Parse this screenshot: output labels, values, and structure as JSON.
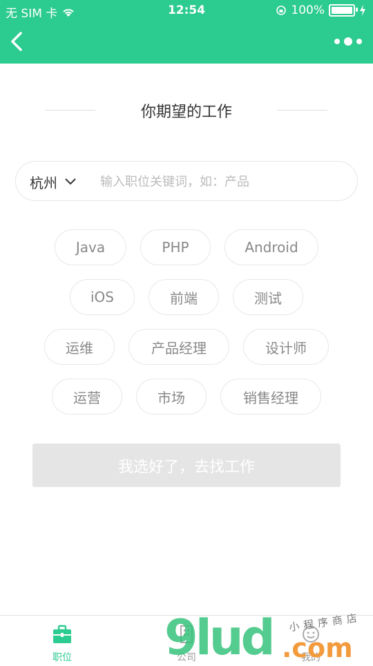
{
  "status_bar": {
    "carrier": "无 SIM 卡",
    "time": "12:54",
    "battery": "100%"
  },
  "header": {
    "back_icon": "chevron-left-icon",
    "more_icon": "more-dots-icon",
    "color": "#2ccb90"
  },
  "title": "你期望的工作",
  "search": {
    "city": "杭州",
    "placeholder": "输入职位关键词，如：产品"
  },
  "tags": [
    "Java",
    "PHP",
    "Android",
    "iOS",
    "前端",
    "测试",
    "运维",
    "产品经理",
    "设计师",
    "运营",
    "市场",
    "销售经理"
  ],
  "submit_label": "我选好了，去找工作",
  "tabbar": {
    "items": [
      {
        "label": "职位",
        "icon": "briefcase-icon",
        "active": true
      },
      {
        "label": "公司",
        "icon": "building-icon",
        "active": false
      },
      {
        "label": "我的",
        "icon": "user-icon",
        "active": false
      }
    ]
  },
  "watermark": {
    "logo": "9lud",
    "suffix": ".com",
    "cn": "小程序商店"
  }
}
